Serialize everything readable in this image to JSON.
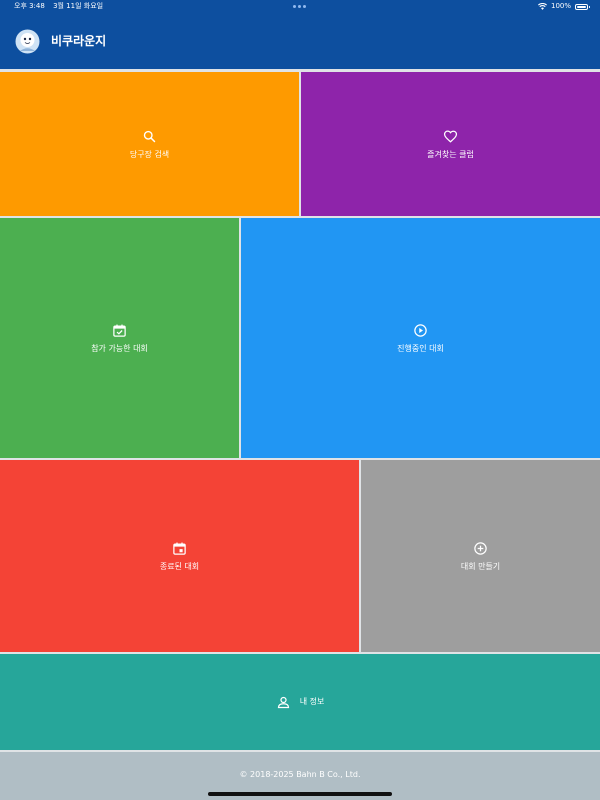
{
  "status_bar": {
    "time": "오후 3:48",
    "date": "3월 11일 화요일",
    "battery": "100%"
  },
  "app_bar": {
    "title": "비쿠라운지"
  },
  "menu": {
    "tiles": [
      {
        "label": "당구장 검색",
        "icon": "search-icon",
        "color": "#fe9a00"
      },
      {
        "label": "즐겨찾는 클럽",
        "icon": "heart-icon",
        "color": "#8e24aa"
      },
      {
        "label": "참가 가능한 대회",
        "icon": "calendar-check-icon",
        "color": "#4caf50"
      },
      {
        "label": "진행중인 대회",
        "icon": "play-circle-icon",
        "color": "#2196f3"
      },
      {
        "label": "종료된 대회",
        "icon": "calendar-event-icon",
        "color": "#f44336"
      },
      {
        "label": "대회 만들기",
        "icon": "add-circle-icon",
        "color": "#9e9e9e"
      },
      {
        "label": "내 정보",
        "icon": "person-icon",
        "color": "#26a69a"
      }
    ]
  },
  "footer": {
    "copyright": "© 2018-2025 Bahn B Co., Ltd."
  },
  "colors": {
    "app_bar": "#0d4f9f",
    "footer": "#b0bec5"
  }
}
